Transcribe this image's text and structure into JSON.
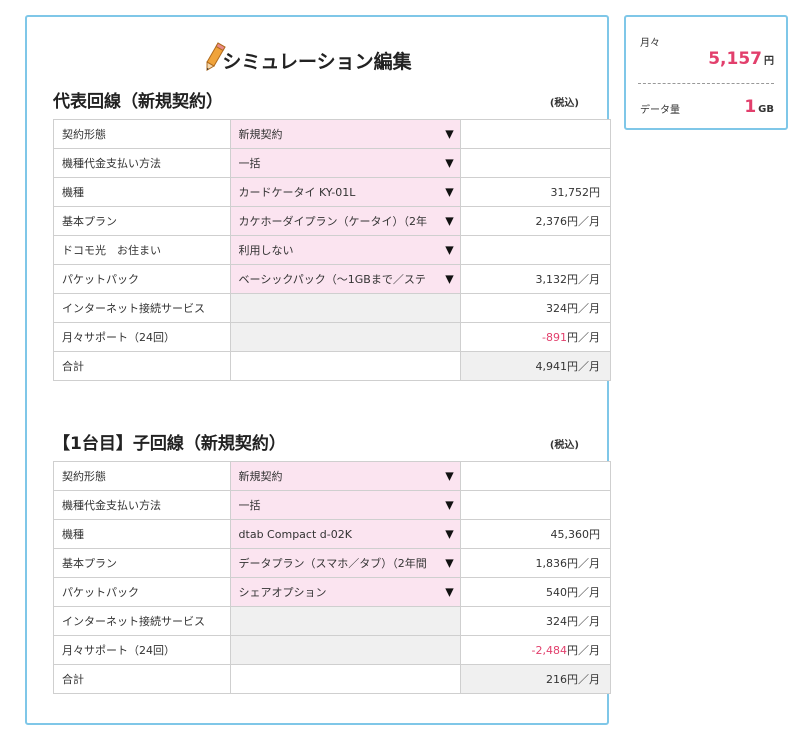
{
  "page_title": "シミュレーション編集",
  "summary": {
    "monthly_label": "月々",
    "monthly_value": "5,157",
    "monthly_unit": "円",
    "data_label": "データ量",
    "data_value": "1",
    "data_unit": "GB"
  },
  "sections": [
    {
      "title": "代表回線（新規契約）",
      "tax_note": "(税込)",
      "rows": [
        {
          "label": "契約形態",
          "select": "新規契約",
          "amount": "",
          "unit": ""
        },
        {
          "label": "機種代金支払い方法",
          "select": "一括",
          "amount": "",
          "unit": ""
        },
        {
          "label": "機種",
          "select": "カードケータイ KY-01L",
          "amount": "31,752",
          "unit": "円"
        },
        {
          "label": "基本プラン",
          "select": "カケホーダイプラン（ケータイ）（2年",
          "amount": "2,376",
          "unit": "円／月"
        },
        {
          "label": "ドコモ光　お住まい",
          "select": "利用しない",
          "amount": "",
          "unit": ""
        },
        {
          "label": "パケットパック",
          "select": "ベーシックパック（〜1GBまで／ステ",
          "amount": "3,132",
          "unit": "円／月"
        },
        {
          "label": "インターネット接続サービス",
          "select": "",
          "amount": "324",
          "unit": "円／月"
        },
        {
          "label": "月々サポート（24回）",
          "select": "",
          "amount": "-891",
          "unit": "円／月"
        },
        {
          "label": "合計",
          "select": "",
          "amount": "4,941",
          "unit": "円／月"
        }
      ]
    },
    {
      "title": "【1台目】子回線（新規契約）",
      "tax_note": "(税込)",
      "rows": [
        {
          "label": "契約形態",
          "select": "新規契約",
          "amount": "",
          "unit": ""
        },
        {
          "label": "機種代金支払い方法",
          "select": "一括",
          "amount": "",
          "unit": ""
        },
        {
          "label": "機種",
          "select": "dtab Compact d-02K",
          "amount": "45,360",
          "unit": "円"
        },
        {
          "label": "基本プラン",
          "select": "データプラン（スマホ／タブ）（2年間",
          "amount": "1,836",
          "unit": "円／月"
        },
        {
          "label": "パケットパック",
          "select": "シェアオプション",
          "amount": "540",
          "unit": "円／月"
        },
        {
          "label": "インターネット接続サービス",
          "select": "",
          "amount": "324",
          "unit": "円／月"
        },
        {
          "label": "月々サポート（24回）",
          "select": "",
          "amount": "-2,484",
          "unit": "円／月"
        },
        {
          "label": "合計",
          "select": "",
          "amount": "216",
          "unit": "円／月"
        }
      ]
    }
  ],
  "colors": {
    "accent": "#7fc7e8",
    "negative": "#e23f6c",
    "select_bg": "#fbe4f0"
  }
}
